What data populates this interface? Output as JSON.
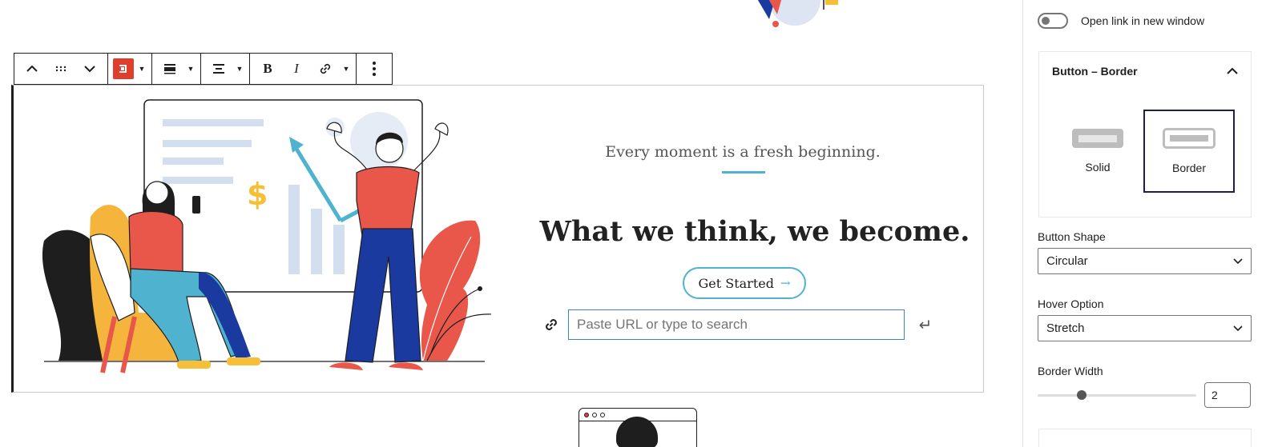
{
  "toolbar": {
    "move_up_icon": "chevron-up",
    "drag_icon": "drag-handle",
    "move_down_icon": "chevron-down",
    "block_type_icon": "button-block",
    "block_color": "#e03e2d"
  },
  "hero": {
    "tagline": "Every moment is a fresh beginning.",
    "headline": "What we think, we become.",
    "cta_label": "Get Started",
    "cta_arrow": "→",
    "accent": "#4fb3cf",
    "dollar_sign": "$",
    "url_placeholder": "Paste URL or type to search",
    "submit_glyph": "↵"
  },
  "sidebar": {
    "open_new_window_label": "Open link in new window",
    "panel_title": "Button – Border",
    "styles": [
      {
        "label": "Solid",
        "active": false
      },
      {
        "label": "Border",
        "active": true
      }
    ],
    "button_shape_label": "Button Shape",
    "button_shape_value": "Circular",
    "hover_option_label": "Hover Option",
    "hover_option_value": "Stretch",
    "border_width_label": "Border Width",
    "border_width_value": "2"
  }
}
